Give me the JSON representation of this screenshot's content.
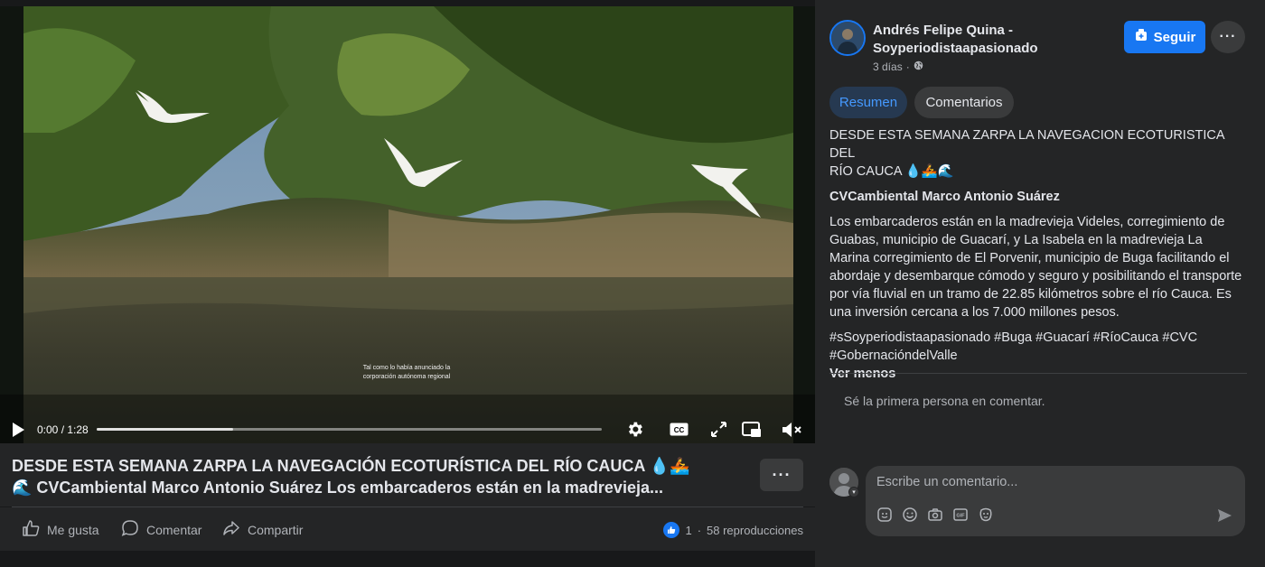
{
  "video": {
    "subtitle_line1": "Tal como lo había anunciado la",
    "subtitle_line2": "corporación autónoma regional",
    "time": "0:00 / 1:28",
    "progress_fraction": 0.0,
    "buffered_fraction": 0.27,
    "icons": [
      "play-icon",
      "settings-gear-icon",
      "captions-icon",
      "fullscreen-icon",
      "picture-in-picture-icon",
      "volume-muted-icon"
    ]
  },
  "post": {
    "title_line1": "DESDE ESTA SEMANA ZARPA LA NAVEGACIÓN ECOTURÍSTICA DEL RÍO CAUCA 💧🚣",
    "title_line2": "🌊 CVCambiental Marco Antonio Suárez Los embarcaderos están en la madrevieja...",
    "more_label": "···",
    "actions": {
      "like": "Me gusta",
      "comment": "Comentar",
      "share": "Compartir"
    },
    "likes_count": "1",
    "views": "58 reproducciones"
  },
  "sidebar": {
    "author_line1": "Andrés Felipe Quina -",
    "author_line2": "Soyperiodistaapasionado",
    "time_ago": "3 días",
    "follow_label": "Seguir",
    "more_label": "···",
    "tabs": [
      {
        "label": "Resumen",
        "active": true
      },
      {
        "label": "Comentarios",
        "active": false
      }
    ],
    "desc_title_line1": "DESDE ESTA SEMANA ZARPA LA NAVEGACION ECOTURISTICA DEL",
    "desc_title_line2": "RÍO CAUCA 💧🚣🌊",
    "desc_byline": "CVCambiental Marco Antonio Suárez",
    "desc_body": "Los embarcaderos están en la madrevieja Videles, corregimiento de Guabas, municipio de Guacarí, y La Isabela en la madrevieja La Marina corregimiento de El Porvenir, municipio de Buga facilitando el abordaje y desembarque cómodo y seguro y posibilitando el transporte por vía fluvial en un tramo de 22.85 kilómetros sobre el río Cauca. Es una inversión cercana a los 7.000 millones pesos.",
    "hashtags_line1": "#sSoyperiodistaapasionado #Buga #Guacarí #RíoCauca #CVC",
    "hashtags_line2": "#GobernacióndelValle",
    "see_less": "Ver menos",
    "first_comment": "Sé la primera persona en comentar.",
    "comment_placeholder": "Escribe un comentario..."
  },
  "colors": {
    "accent": "#1877f2",
    "background": "#18191a",
    "panel": "#242526"
  }
}
